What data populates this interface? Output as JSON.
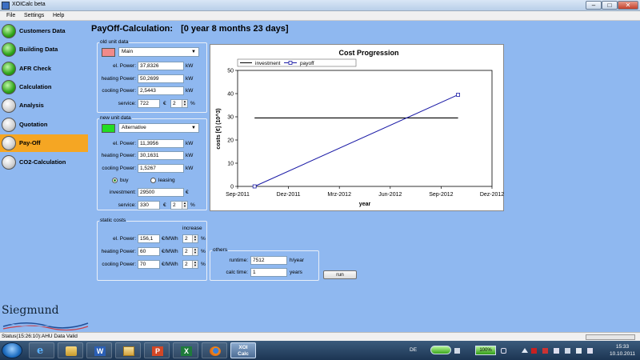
{
  "window": {
    "title": "XOICalc beta"
  },
  "menu": [
    "File",
    "Settings",
    "Help"
  ],
  "sidebar": {
    "items": [
      {
        "label": "Customers Data",
        "status": "green"
      },
      {
        "label": "Building Data",
        "status": "green"
      },
      {
        "label": "AFR Check",
        "status": "green"
      },
      {
        "label": "Calculation",
        "status": "green"
      },
      {
        "label": "Analysis",
        "status": "grey"
      },
      {
        "label": "Quotation",
        "status": "grey"
      },
      {
        "label": "Pay-Off",
        "status": "grey",
        "active": true
      },
      {
        "label": "CO2-Calculation",
        "status": "grey"
      }
    ]
  },
  "headline": {
    "title": "PayOff-Calculation:",
    "value": "[0 year 8 months 23 days]"
  },
  "old_unit": {
    "legend": "old unit data",
    "color": "#f08a8a",
    "select": "Main",
    "el_power_label": "el. Power:",
    "el_power": "37,8326",
    "el_power_unit": "kW",
    "heating_label": "heating Power:",
    "heating": "50,2699",
    "heating_unit": "kW",
    "cooling_label": "cooling Power:",
    "cooling": "2,5443",
    "cooling_unit": "kW",
    "service_label": "service:",
    "service": "722",
    "service_currency": "€",
    "service_increase": "2",
    "service_pct": "%"
  },
  "new_unit": {
    "legend": "new unit data",
    "color": "#22dd22",
    "select": "Alternative",
    "el_power_label": "el. Power:",
    "el_power": "11,3956",
    "el_power_unit": "kW",
    "heating_label": "heating Power:",
    "heating": "30,1631",
    "heating_unit": "kW",
    "cooling_label": "cooling Power:",
    "cooling": "1,5267",
    "cooling_unit": "kW",
    "buy_label": "buy",
    "leasing_label": "leasing",
    "buy_selected": true,
    "investment_label": "investment:",
    "investment": "29500",
    "investment_currency": "€",
    "service_label": "service:",
    "service": "330",
    "service_currency": "€",
    "service_increase": "2",
    "service_pct": "%"
  },
  "static_costs": {
    "legend": "static costs",
    "increase_label": "increase",
    "rows": [
      {
        "label": "el. Power:",
        "value": "156,1",
        "unit": "€/MWh",
        "increase": "2",
        "pct": "%"
      },
      {
        "label": "heating Power:",
        "value": "60",
        "unit": "€/MWh",
        "increase": "2",
        "pct": "%"
      },
      {
        "label": "cooling Power:",
        "value": "70",
        "unit": "€/MWh",
        "increase": "2",
        "pct": "%"
      }
    ]
  },
  "others": {
    "legend": "others",
    "runtime_label": "runtime:",
    "runtime": "7512",
    "runtime_unit": "h/year",
    "calc_label": "calc time:",
    "calc": "1",
    "calc_unit": "years"
  },
  "run_label": "run",
  "logo_text": "Siegmund",
  "status": {
    "text": "Status(15:26:10):AHU Data Valid"
  },
  "taskbar": {
    "current_app_label_1": "XOI",
    "current_app_label_2": "Calc",
    "language": "DE",
    "battery_percent": "100%",
    "time": "15:33",
    "date": "10.10.2011"
  },
  "colors": {
    "active": "#f5a623",
    "background": "#8fb8f0",
    "series_investment": "#000000",
    "series_payoff": "#1a1aa6"
  },
  "chart_data": {
    "type": "line",
    "title": "Cost Progression",
    "xlabel": "year",
    "ylabel": "costs [€] (10^3)",
    "ylim": [
      0,
      50
    ],
    "yticks": [
      0,
      10,
      20,
      30,
      40,
      50
    ],
    "xticks": [
      "Sep-2011",
      "Dez-2011",
      "Mrz-2012",
      "Jun-2012",
      "Sep-2012",
      "Dez-2012"
    ],
    "xlim": [
      "2011-09",
      "2012-12"
    ],
    "legend_position": "top-left",
    "series": [
      {
        "name": "investment",
        "x": [
          "2011-10",
          "2012-10"
        ],
        "y": [
          29.5,
          29.5
        ],
        "marker": "none"
      },
      {
        "name": "payoff",
        "x": [
          "2011-10",
          "2012-10"
        ],
        "y": [
          0,
          39.5
        ],
        "marker": "square"
      }
    ]
  }
}
